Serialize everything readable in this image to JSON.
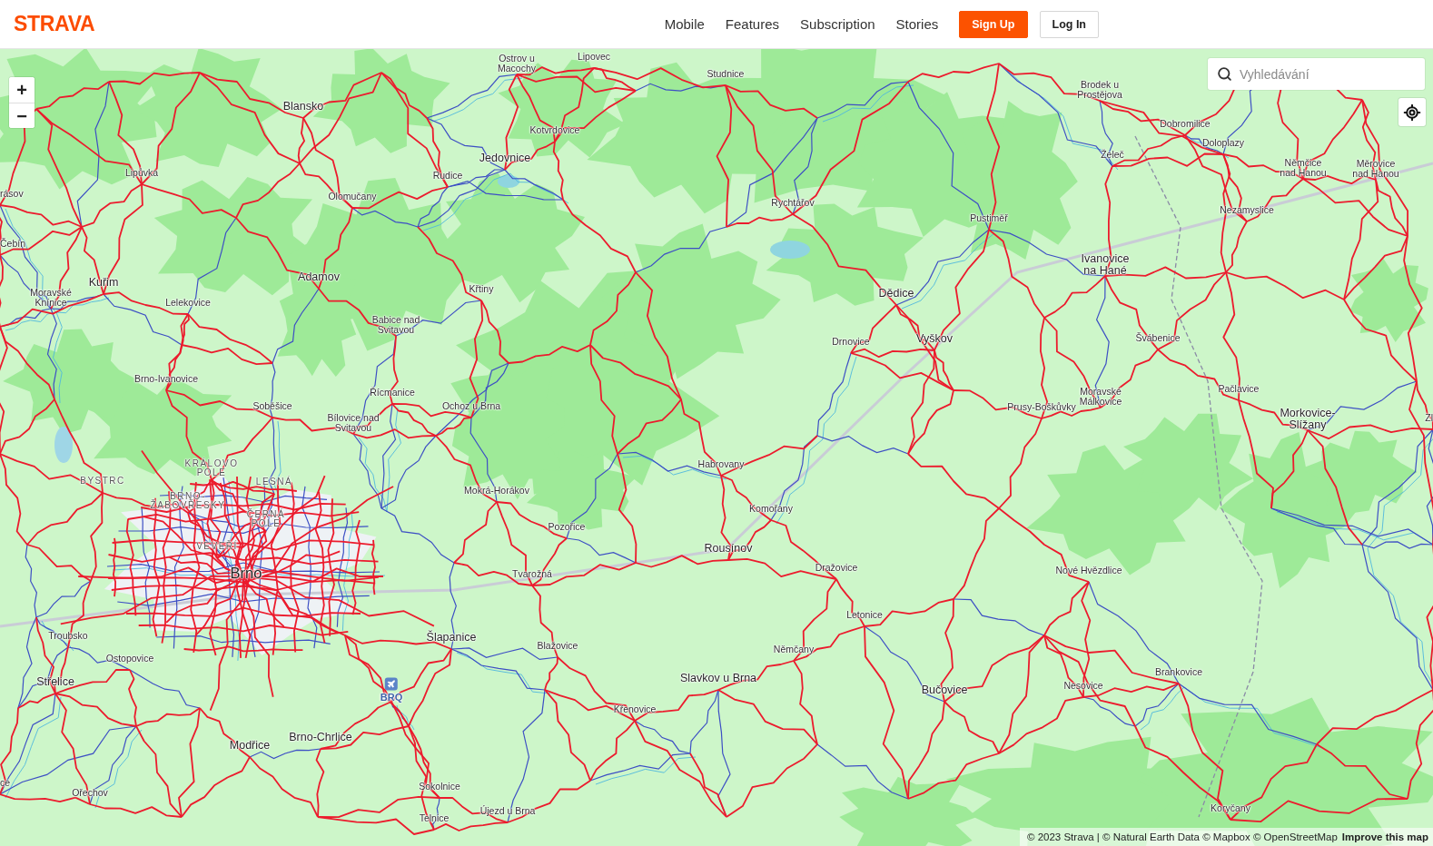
{
  "header": {
    "logo": "STRAVA",
    "nav": [
      "Mobile",
      "Features",
      "Subscription",
      "Stories"
    ],
    "signup": "Sign Up",
    "login": "Log In"
  },
  "map": {
    "zoom_controls": [
      "+",
      "−"
    ],
    "search": {
      "placeholder": "Vyhledávání"
    },
    "labels": [
      {
        "text": "Ostrov u Macochy",
        "kind": "village"
      },
      {
        "text": "Lipovec",
        "kind": "village"
      },
      {
        "text": "Studnice",
        "kind": "village"
      },
      {
        "text": "Brodek u Prostějova",
        "kind": "village"
      },
      {
        "text": "Blansko",
        "kind": "town"
      },
      {
        "text": "Dobromilice",
        "kind": "village"
      },
      {
        "text": "Kotvrdovice",
        "kind": "village"
      },
      {
        "text": "Doloplazy",
        "kind": "village"
      },
      {
        "text": "Jedovnice",
        "kind": "town"
      },
      {
        "text": "Želeč",
        "kind": "village"
      },
      {
        "text": "Lipůvka",
        "kind": "village"
      },
      {
        "text": "Rudice",
        "kind": "village"
      },
      {
        "text": "Němčice nad Hanou",
        "kind": "village"
      },
      {
        "text": "Měrovice nad Hanou",
        "kind": "village"
      },
      {
        "text": "rásov",
        "kind": "village"
      },
      {
        "text": "Olomučany",
        "kind": "village"
      },
      {
        "text": "Rychtářov",
        "kind": "village"
      },
      {
        "text": "Nezamyslice",
        "kind": "village"
      },
      {
        "text": "Pustiměř",
        "kind": "village"
      },
      {
        "text": "Čebín",
        "kind": "village"
      },
      {
        "text": "Ivanovice na Hané",
        "kind": "town"
      },
      {
        "text": "Kuřim",
        "kind": "town"
      },
      {
        "text": "Adamov",
        "kind": "town"
      },
      {
        "text": "Moravské Knínice",
        "kind": "village"
      },
      {
        "text": "Křtiny",
        "kind": "village"
      },
      {
        "text": "Dědice",
        "kind": "town"
      },
      {
        "text": "Lelekovice",
        "kind": "village"
      },
      {
        "text": "Babice nad Svitavou",
        "kind": "village"
      },
      {
        "text": "Drnovice",
        "kind": "village"
      },
      {
        "text": "Vyškov",
        "kind": "town"
      },
      {
        "text": "Švábenice",
        "kind": "village"
      },
      {
        "text": "Brno-Ivanovice",
        "kind": "village"
      },
      {
        "text": "Řícmanice",
        "kind": "village"
      },
      {
        "text": "Moravské Málkovice",
        "kind": "village"
      },
      {
        "text": "Pačlavice",
        "kind": "village"
      },
      {
        "text": "Soběšice",
        "kind": "village"
      },
      {
        "text": "Ochoz u Brna",
        "kind": "village"
      },
      {
        "text": "Prusy-Boškůvky",
        "kind": "village"
      },
      {
        "text": "Bílovice nad Svitavou",
        "kind": "village"
      },
      {
        "text": "Morkovice-Slížany",
        "kind": "town"
      },
      {
        "text": "Zl",
        "kind": "village"
      },
      {
        "text": "KRÁLOVO POLE",
        "kind": "district"
      },
      {
        "text": "Habrovany",
        "kind": "village"
      },
      {
        "text": "BYSTRC",
        "kind": "district"
      },
      {
        "text": "LESNÁ",
        "kind": "district"
      },
      {
        "text": "Mokrá-Horákov",
        "kind": "village"
      },
      {
        "text": "BRNO-ŽABOVŘESKY",
        "kind": "district"
      },
      {
        "text": "Komořany",
        "kind": "village"
      },
      {
        "text": "ČERNÁ POLE",
        "kind": "district"
      },
      {
        "text": "Pozořice",
        "kind": "village"
      },
      {
        "text": "VEVEŘÍ",
        "kind": "district"
      },
      {
        "text": "Rousínov",
        "kind": "town"
      },
      {
        "text": "Brno",
        "kind": "city"
      },
      {
        "text": "Dražovice",
        "kind": "village"
      },
      {
        "text": "Tvarožná",
        "kind": "village"
      },
      {
        "text": "Nové Hvězdlice",
        "kind": "village"
      },
      {
        "text": "Letonice",
        "kind": "village"
      },
      {
        "text": "Troubsko",
        "kind": "village"
      },
      {
        "text": "Šlapanice",
        "kind": "town"
      },
      {
        "text": "Blažovice",
        "kind": "village"
      },
      {
        "text": "Němčany",
        "kind": "village"
      },
      {
        "text": "Ostopovice",
        "kind": "village"
      },
      {
        "text": "Brankovice",
        "kind": "village"
      },
      {
        "text": "Střelice",
        "kind": "town"
      },
      {
        "text": "Slavkov u Brna",
        "kind": "town"
      },
      {
        "text": "Bučovice",
        "kind": "town"
      },
      {
        "text": "Nesovice",
        "kind": "village"
      },
      {
        "text": "BRQ",
        "kind": "airport"
      },
      {
        "text": "Křenovice",
        "kind": "village"
      },
      {
        "text": "Brno-Chrlice",
        "kind": "town"
      },
      {
        "text": "Modřice",
        "kind": "town"
      },
      {
        "text": "ce",
        "kind": "village"
      },
      {
        "text": "Sokolnice",
        "kind": "village"
      },
      {
        "text": "Ořechov",
        "kind": "village"
      },
      {
        "text": "Újezd u Brna",
        "kind": "village"
      },
      {
        "text": "Koryčany",
        "kind": "village"
      },
      {
        "text": "Telnice",
        "kind": "village"
      }
    ]
  },
  "attribution": {
    "text": "© 2023 Strava | © Natural Earth Data © Mapbox © OpenStreetMap",
    "link": "Improve this map"
  }
}
